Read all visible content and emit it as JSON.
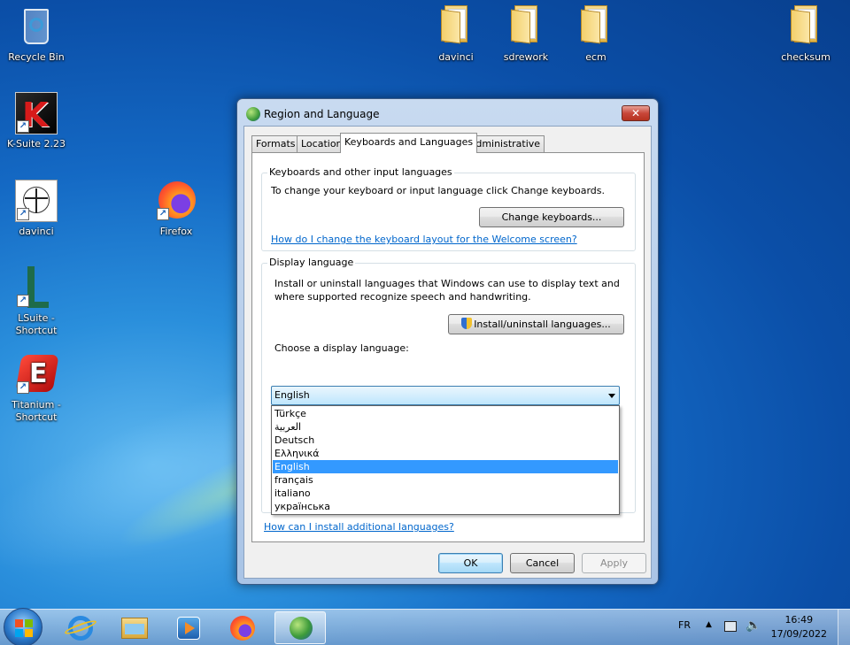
{
  "desktop": {
    "icons": [
      {
        "label": "Recycle Bin"
      },
      {
        "label": "K-Suite 2.23"
      },
      {
        "label": "davinci"
      },
      {
        "label": "Firefox"
      },
      {
        "label": "LSuite - Shortcut"
      },
      {
        "label": "Titanium - Shortcut"
      },
      {
        "label": "davinci"
      },
      {
        "label": "sdrework"
      },
      {
        "label": "ecm"
      },
      {
        "label": "checksum"
      }
    ]
  },
  "dialog": {
    "title": "Region and Language",
    "close_label": "✕",
    "tabs": [
      {
        "label": "Formats"
      },
      {
        "label": "Location"
      },
      {
        "label": "Keyboards and Languages"
      },
      {
        "label": "Administrative"
      }
    ],
    "keyboards_group": {
      "title": "Keyboards and other input languages",
      "description": "To change your keyboard or input language click Change keyboards.",
      "change_button": "Change keyboards...",
      "welcome_link": "How do I change the keyboard layout for the Welcome screen?"
    },
    "display_group": {
      "title": "Display language",
      "description_line1": "Install or uninstall languages that Windows can use to display text and",
      "description_line2": "where supported recognize speech and handwriting.",
      "install_button": "Install/uninstall languages...",
      "choose_label": "Choose a display language:",
      "selected_value": "English",
      "options": [
        "Türkçe",
        "العربية",
        "Deutsch",
        "Ελληνικά",
        "English",
        "français",
        "italiano",
        "українська"
      ]
    },
    "additional_link": "How can I install additional languages?",
    "ok_button": "OK",
    "cancel_button": "Cancel",
    "apply_button": "Apply"
  },
  "taskbar": {
    "language": "FR",
    "time": "16:49",
    "date": "17/09/2022"
  }
}
